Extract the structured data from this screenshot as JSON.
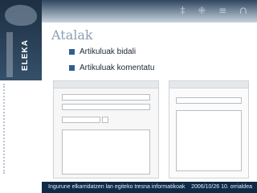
{
  "logo": {
    "text": "ELEKA"
  },
  "slide": {
    "title": "Atalak"
  },
  "bullets": [
    {
      "label": "Artikuluak bidali"
    },
    {
      "label": "Artikuluak komentatu"
    }
  ],
  "footer": {
    "left": "Ingurune elkarridatzen lan egiteko tresna informatikoak",
    "right": "2006/10/26    10. orrialdea"
  },
  "colors": {
    "bullet_marker": "#2f5f8f",
    "footer_bg": "#0f2a47",
    "heading": "#8aa0b3"
  }
}
